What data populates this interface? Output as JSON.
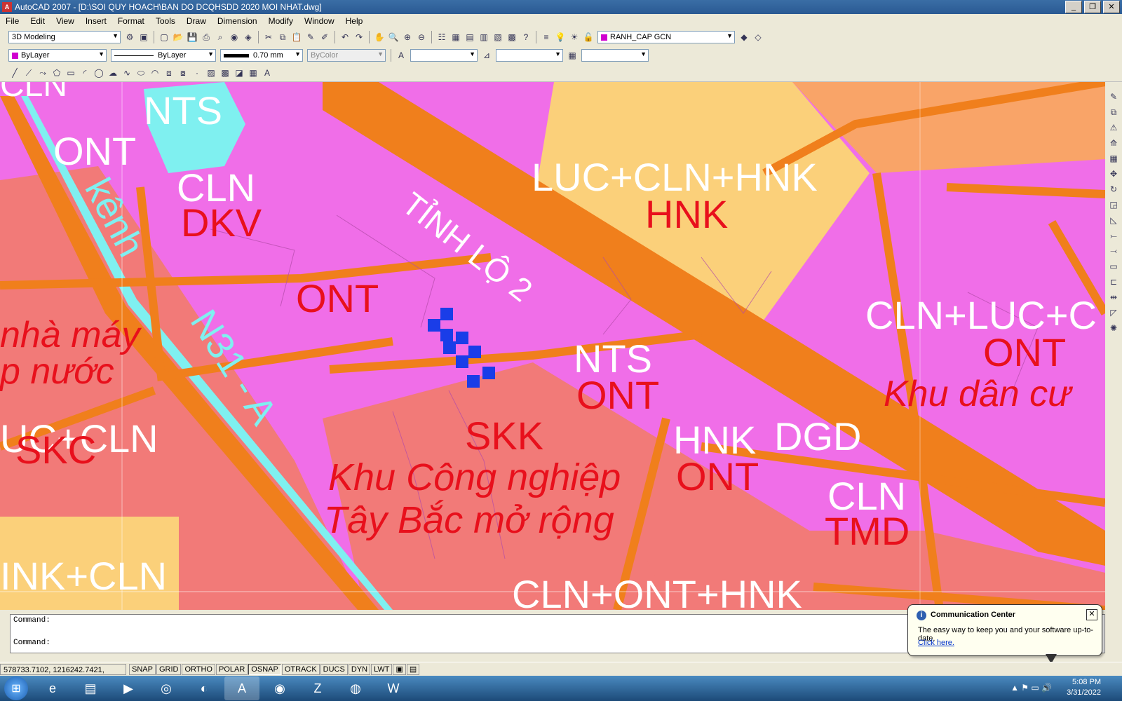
{
  "window": {
    "title": "AutoCAD 2007 - [D:\\SOI QUY HOACH\\BAN DO DCQHSDD 2020 MOI NHAT.dwg]",
    "app_icon": "A"
  },
  "menu": [
    "File",
    "Edit",
    "View",
    "Insert",
    "Format",
    "Tools",
    "Draw",
    "Dimension",
    "Modify",
    "Window",
    "Help"
  ],
  "toolbars": {
    "workspace": "3D Modeling",
    "layer": "RANH_CAP GCN",
    "color": "ByLayer",
    "linetype": "ByLayer",
    "lineweight": "0.70 mm",
    "plotstyle": "ByColor"
  },
  "map_labels": [
    "CLN",
    "NTS",
    "ONT",
    "CLN",
    "DKV",
    "kênh",
    "N31 - A",
    "TỈNH LỘ 2",
    "ONT",
    "LUC+CLN+HNK",
    "HNK",
    "CLN+LUC+C",
    "ONT",
    "Khu dân cư",
    "nhà máy",
    "p nước",
    "UC+CLN",
    "SKC",
    "NTS",
    "ONT",
    "SKK",
    "HNK",
    "DGD",
    "ONT",
    "Khu Công nghiệp",
    "Tây Bắc mở rộng",
    "CLN",
    "TMD",
    "INK+CLN",
    "CLN+ONT+HNK"
  ],
  "command": {
    "line1": "Command:",
    "line2": "Command:"
  },
  "status": {
    "coords": "578733.7102, 1216242.7421, 0.0000",
    "buttons": [
      "SNAP",
      "GRID",
      "ORTHO",
      "POLAR",
      "OSNAP",
      "OTRACK",
      "DUCS",
      "DYN",
      "LWT"
    ]
  },
  "balloon": {
    "title": "Communication Center",
    "message": "The easy way to keep you and your software up-to-date.",
    "link": "Click here."
  },
  "clock": {
    "time": "5:08 PM",
    "date": "3/31/2022"
  },
  "colors": {
    "pink_zone": "#f06ee8",
    "salmon_zone": "#f27a78",
    "orange_road": "#f07f1c",
    "yellow_zone": "#fbd07a",
    "cyan_water": "#7ff0f0",
    "red_text": "#e8101c",
    "selected": "#1a3de8"
  }
}
